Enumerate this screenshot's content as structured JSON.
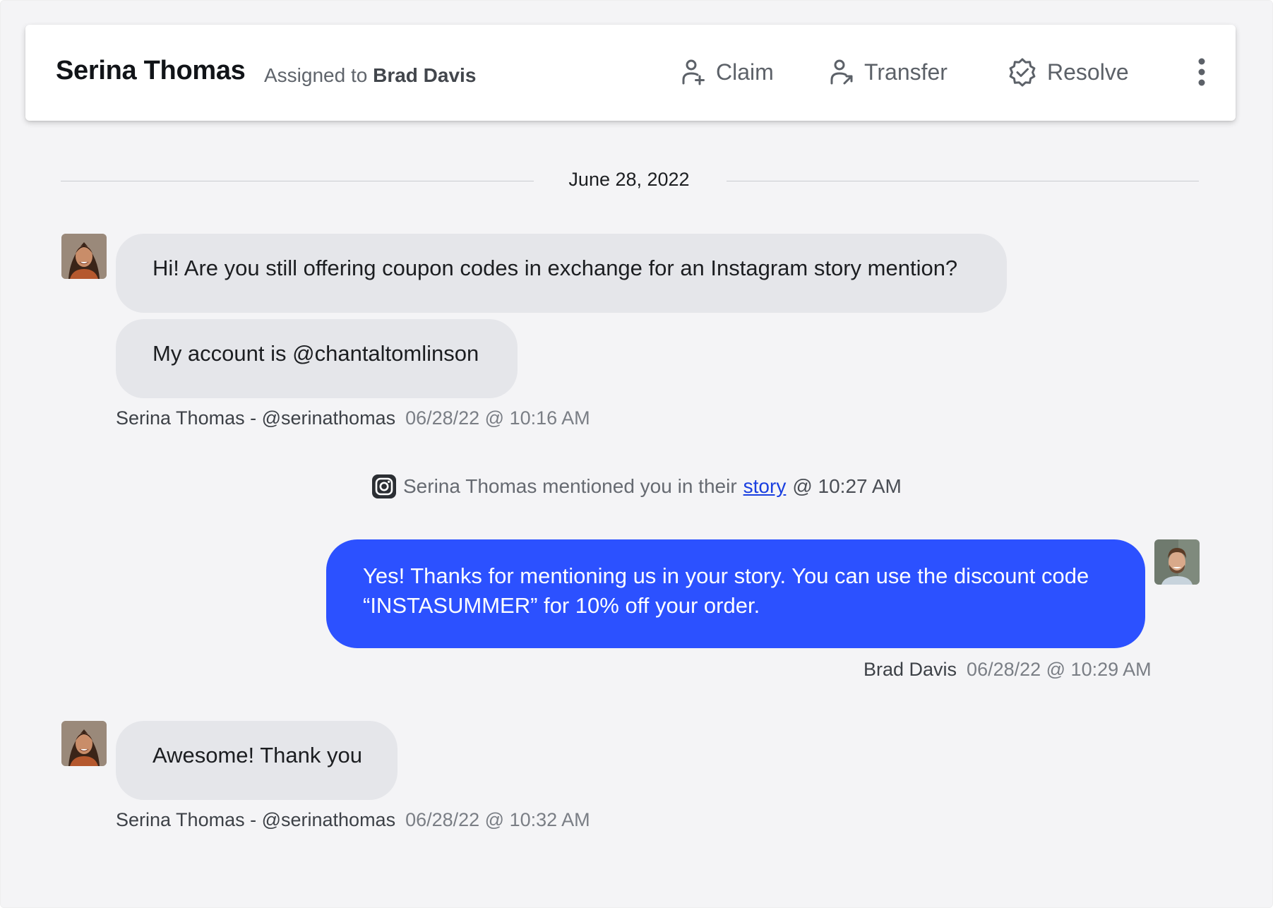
{
  "header": {
    "contact_name": "Serina Thomas",
    "assigned_prefix": "Assigned to",
    "assigned_agent": "Brad Davis",
    "actions": {
      "claim": "Claim",
      "transfer": "Transfer",
      "resolve": "Resolve"
    },
    "icons": {
      "claim": "person-add-icon",
      "transfer": "person-transfer-icon",
      "resolve": "badge-check-icon",
      "more": "vertical-ellipsis-icon"
    }
  },
  "conversation": {
    "date_divider": "June 28, 2022",
    "messages": [
      {
        "direction": "incoming",
        "text": "Hi! Are you still offering coupon codes in exchange for an Instagram story mention?"
      },
      {
        "direction": "incoming",
        "text": "My account is @chantaltomlinson"
      },
      {
        "direction": "incoming",
        "text": "Awesome! Thank you"
      }
    ],
    "meta_1": {
      "sender": "Serina Thomas - @serinathomas",
      "time": "06/28/22 @ 10:16 AM"
    },
    "event": {
      "icon": "instagram-icon",
      "text": "Serina Thomas mentioned you in their",
      "link": "story",
      "time": "@ 10:27 AM"
    },
    "reply": {
      "line1": "Yes! Thanks for mentioning us in your story. You can use the discount code",
      "line2": "“INSTASUMMER” for 10% off your order.",
      "sender": "Brad Davis",
      "time": "06/28/22 @ 10:29 AM"
    },
    "meta_2": {
      "sender": "Serina Thomas - @serinathomas",
      "time": "06/28/22 @ 10:32 AM"
    }
  },
  "colors": {
    "outgoing_bubble": "#2c51ff",
    "incoming_bubble": "#e5e6ea",
    "background": "#f4f4f6",
    "link": "#1a3fe0"
  }
}
